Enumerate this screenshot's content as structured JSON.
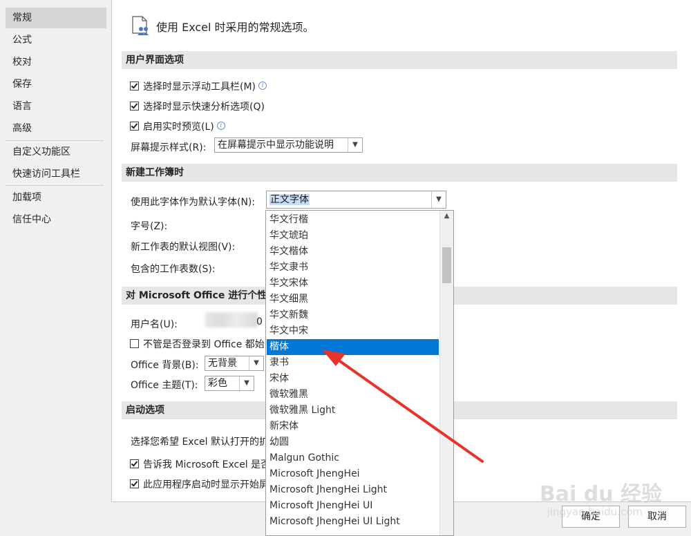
{
  "sidebar": {
    "items": [
      "常规",
      "公式",
      "校对",
      "保存",
      "语言",
      "高级",
      "自定义功能区",
      "快速访问工具栏",
      "加载项",
      "信任中心"
    ]
  },
  "header": {
    "title": "使用 Excel 时采用的常规选项。"
  },
  "sections": {
    "ui": "用户界面选项",
    "workbook": "新建工作簿时",
    "personalize": "对 Microsoft Office 进行个性化",
    "startup": "启动选项"
  },
  "ui_options": {
    "float_toolbar": "选择时显示浮动工具栏(M)",
    "quick_analysis": "选择时显示快速分析选项(Q)",
    "live_preview": "启用实时预览(L)",
    "screentip_label": "屏幕提示样式(R):",
    "screentip_value": "在屏幕提示中显示功能说明"
  },
  "workbook": {
    "font_label": "使用此字体作为默认字体(N):",
    "font_value": "正文字体",
    "size_label": "字号(Z):",
    "view_label": "新工作表的默认视图(V):",
    "sheets_label": "包含的工作表数(S):"
  },
  "personalize": {
    "username_label": "用户名(U):",
    "username_partial": "0",
    "always_use": "不管是否登录到 Office 都始",
    "bg_label": "Office 背景(B):",
    "bg_value": "无背景",
    "theme_label": "Office 主题(T):",
    "theme_value": "彩色"
  },
  "startup": {
    "choose_ext": "选择您希望 Excel 默认打开的扩",
    "tell_me": "告诉我 Microsoft Excel 是否",
    "show_start": "此应用程序启动时显示开始屏"
  },
  "font_dropdown": {
    "items": [
      "华文行楷",
      "华文琥珀",
      "华文楷体",
      "华文隶书",
      "华文宋体",
      "华文细黑",
      "华文新魏",
      "华文中宋",
      "楷体",
      "隶书",
      "宋体",
      "微软雅黑",
      "微软雅黑 Light",
      "新宋体",
      "幼圆",
      "Malgun Gothic",
      "Microsoft JhengHei",
      "Microsoft JhengHei Light",
      "Microsoft JhengHei UI",
      "Microsoft JhengHei UI Light"
    ],
    "selected_index": 8
  },
  "buttons": {
    "ok": "确定",
    "cancel": "取消"
  },
  "watermark": {
    "brand": "Bai du 经验",
    "url": "jingyan.baidu.com"
  },
  "colors": {
    "accent": "#0078d7",
    "arrow": "#e8332a"
  }
}
